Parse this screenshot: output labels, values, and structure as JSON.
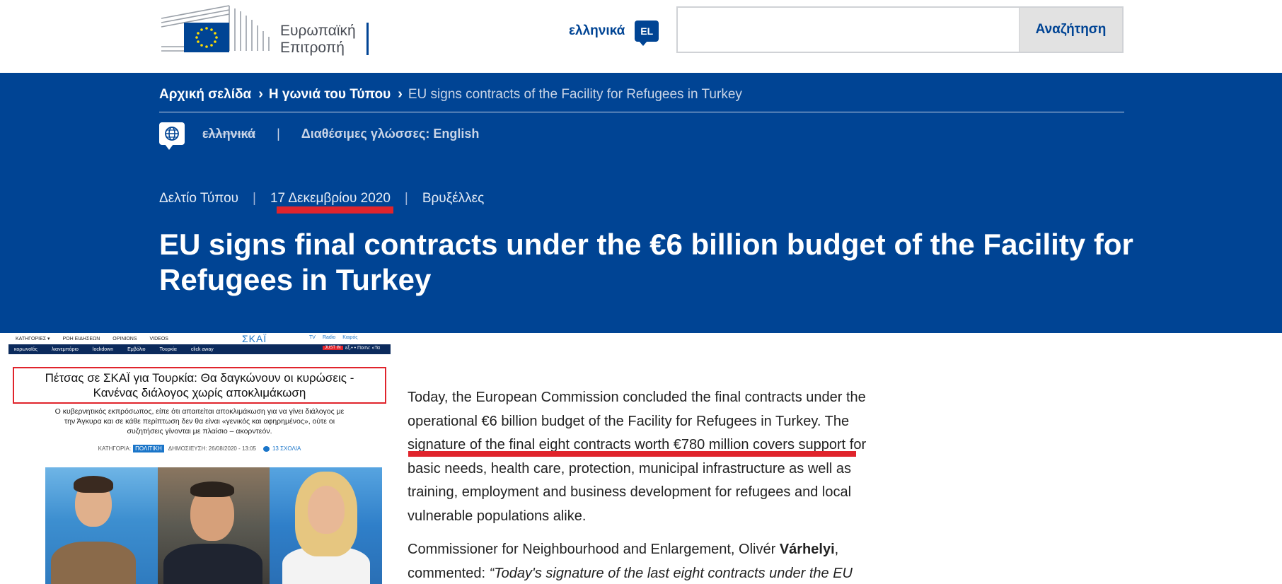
{
  "header": {
    "logo_line1": "Ευρωπαϊκή",
    "logo_line2": "Επιτροπή",
    "language_label": "ελληνικά",
    "language_code": "EL",
    "search_placeholder": "",
    "search_button": "Αναζήτηση"
  },
  "breadcrumb": {
    "items": [
      "Αρχική σελίδα",
      "Η γωνιά του Τύπου"
    ],
    "current": "EU signs contracts of the Facility for Refugees in Turkey"
  },
  "languages": {
    "current": "ελληνικά",
    "available": "Διαθέσιμες γλώσσες: English"
  },
  "meta": {
    "type": "Δελτίο Τύπου",
    "date": "17 Δεκεμβρίου 2020",
    "place": "Βρυξέλλες"
  },
  "headline": "EU signs final contracts under the €6 billion budget of the Facility for Refugees in Turkey",
  "inset": {
    "topnav": [
      "ΚΑΤΗΓΟΡΙΕΣ ▾",
      "ΡΟΗ ΕΙΔΗΣΕΩΝ",
      "OPINIONS",
      "VIDEOS"
    ],
    "logo": "ΣΚΑΪ",
    "top_right": [
      "TV",
      "Radio",
      "Καιρός"
    ],
    "subnav": [
      "κορωνοϊός",
      "λιανεμπόριο",
      "lockdown",
      "Εμβόλιο",
      "Τουρκία",
      "click away"
    ],
    "just_in": "JUST IN",
    "subnav_extra": "εξ.• • Ποιτν: «Τα",
    "title_line1": "Πέτσας σε ΣΚΑΪ για Τουρκία: Θα δαγκώνουν οι κυρώσεις -",
    "title_line2": "Κανένας διάλογος χωρίς αποκλιμάκωση",
    "lead": "Ο κυβερνητικός εκπρόσωπος, είπε ότι απαιτείται αποκλιμάκωση για να γίνει διάλογος με την Άγκυρα και σε κάθε περίπτωση δεν θα είναι «γενικός και αφηρημένος», ούτε οι συζητήσεις γίνονται με πλαίσιο – ακορντεόν.",
    "meta_category_label": "ΚΑΤΗΓΟΡΙΑ:",
    "meta_category": "ΠΟΛΙΤΙΚΗ",
    "meta_published": "ΔΗΜΟΣΙΕΥΣΗ: 26/08/2020 - 13:05",
    "meta_comments": "13 ΣΧΟΛΙΑ"
  },
  "article": {
    "para1": "Today, the European Commission concluded the final contracts under the operational €6 billion budget of the Facility for Refugees in Turkey. The signature of the final eight contracts worth €780 million covers support for basic needs, health care, protection, municipal infrastructure as well as training, employment and business development for refugees and local vulnerable populations alike.",
    "para2_start": "Commissioner for Neighbourhood and Enlargement, Olivér ",
    "para2_name": "Várhelyi",
    "para2_after": ", commented: ",
    "para2_quote": "“Today's signature of the last eight contracts under the EU"
  },
  "colors": {
    "ec_blue": "#004494",
    "highlight_red": "#e0242c",
    "skai_blue": "#1a75c9"
  }
}
